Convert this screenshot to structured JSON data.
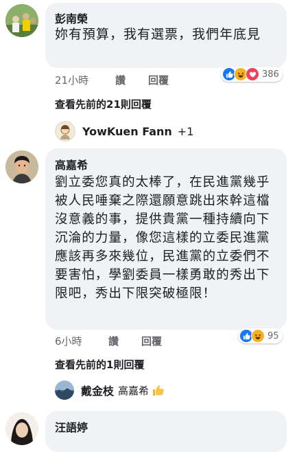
{
  "comments": [
    {
      "author": "彭南榮",
      "text": "妳有預算，我有選票，我們年底見",
      "time": "21小時",
      "like_label": "讚",
      "reply_label": "回覆",
      "reaction_count": "386",
      "view_previous": "查看先前的21則回覆",
      "reply_preview": {
        "name": "YowKuen Fann",
        "extra": "+1"
      }
    },
    {
      "author": "高嘉希",
      "text": "劉立委您真的太棒了，在民進黨幾乎被人民唾棄之際還願意跳出來幹這檔沒意義的事，提供貴黨一種持續向下沉淪的力量，像您這樣的立委民進黨應該再多來幾位，民進黨的立委們不要害怕，學劉委員一樣勇敢的秀出下限吧，秀出下限突破極限！",
      "time": "6小時",
      "like_label": "讚",
      "reply_label": "回覆",
      "reaction_count": "95",
      "view_previous": "查看先前的1則回覆",
      "reply_preview": {
        "name": "戴金枝",
        "mention": "高嘉希"
      }
    },
    {
      "author": "汪語婷"
    }
  ],
  "colors": {
    "like_blue": "#1877f2",
    "love_red": "#f33e58",
    "haha_yellow": "#f7b125",
    "bubble_bg": "#f0f2f5",
    "meta_gray": "#65676b"
  }
}
